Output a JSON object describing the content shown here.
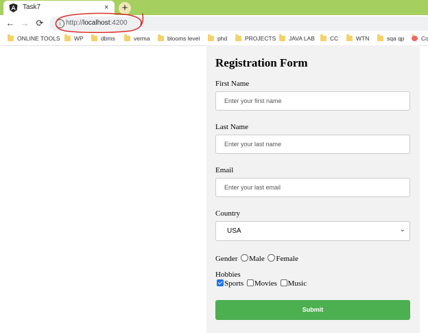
{
  "browser": {
    "tab_title": "Task7",
    "tab_close": "×",
    "new_tab": "+",
    "url_prefix": "http://",
    "url_host": "localhost",
    "url_port": ":4200",
    "back": "←",
    "forward": "→",
    "reload": "⟳",
    "info": "i"
  },
  "bookmarks": [
    "ONLINE TOOLS",
    "WP",
    "dbms",
    "verma",
    "blooms level",
    "phd",
    "PROJECTS",
    "JAVA LAB",
    "CC",
    "WTN",
    "sqa qp",
    "Co"
  ],
  "form": {
    "title": "Registration Form",
    "first_name_label": "First Name",
    "first_name_placeholder": "Enter your first name",
    "last_name_label": "Last Name",
    "last_name_placeholder": "Enter your last name",
    "email_label": "Email",
    "email_placeholder": "Enter your last email",
    "country_label": "Country",
    "country_value": "USA",
    "gender_label": "Gender",
    "gender_options": [
      "Male",
      "Female"
    ],
    "hobbies_label": "Hobbies",
    "hobbies": [
      {
        "label": "Sports",
        "checked": true
      },
      {
        "label": "Movies",
        "checked": false
      },
      {
        "label": "Music",
        "checked": false
      }
    ],
    "submit_label": "Submit",
    "submit_color": "#4caf50",
    "panel_color": "#f2f2f2"
  },
  "annotation_color": "#d92b2b",
  "tabbar_color": "#a5cf5e"
}
